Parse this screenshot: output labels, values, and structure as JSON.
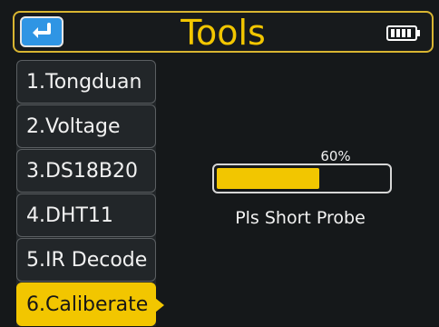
{
  "header": {
    "title": "Tools",
    "back_icon": "return-arrow-icon",
    "battery_icon": "battery-full-icon"
  },
  "menu": {
    "items": [
      {
        "label": "1.Tongduan",
        "selected": false
      },
      {
        "label": "2.Voltage",
        "selected": false
      },
      {
        "label": "3.DS18B20",
        "selected": false
      },
      {
        "label": "4.DHT11",
        "selected": false
      },
      {
        "label": "5.IR Decode",
        "selected": false
      },
      {
        "label": "6.Caliberate",
        "selected": true
      }
    ]
  },
  "calibration": {
    "progress_percent": 60,
    "progress_text": "60%",
    "status": "Pls Short Probe"
  },
  "colors": {
    "accent": "#f2c600",
    "back_button": "#2f95e4",
    "background": "#15181a"
  }
}
